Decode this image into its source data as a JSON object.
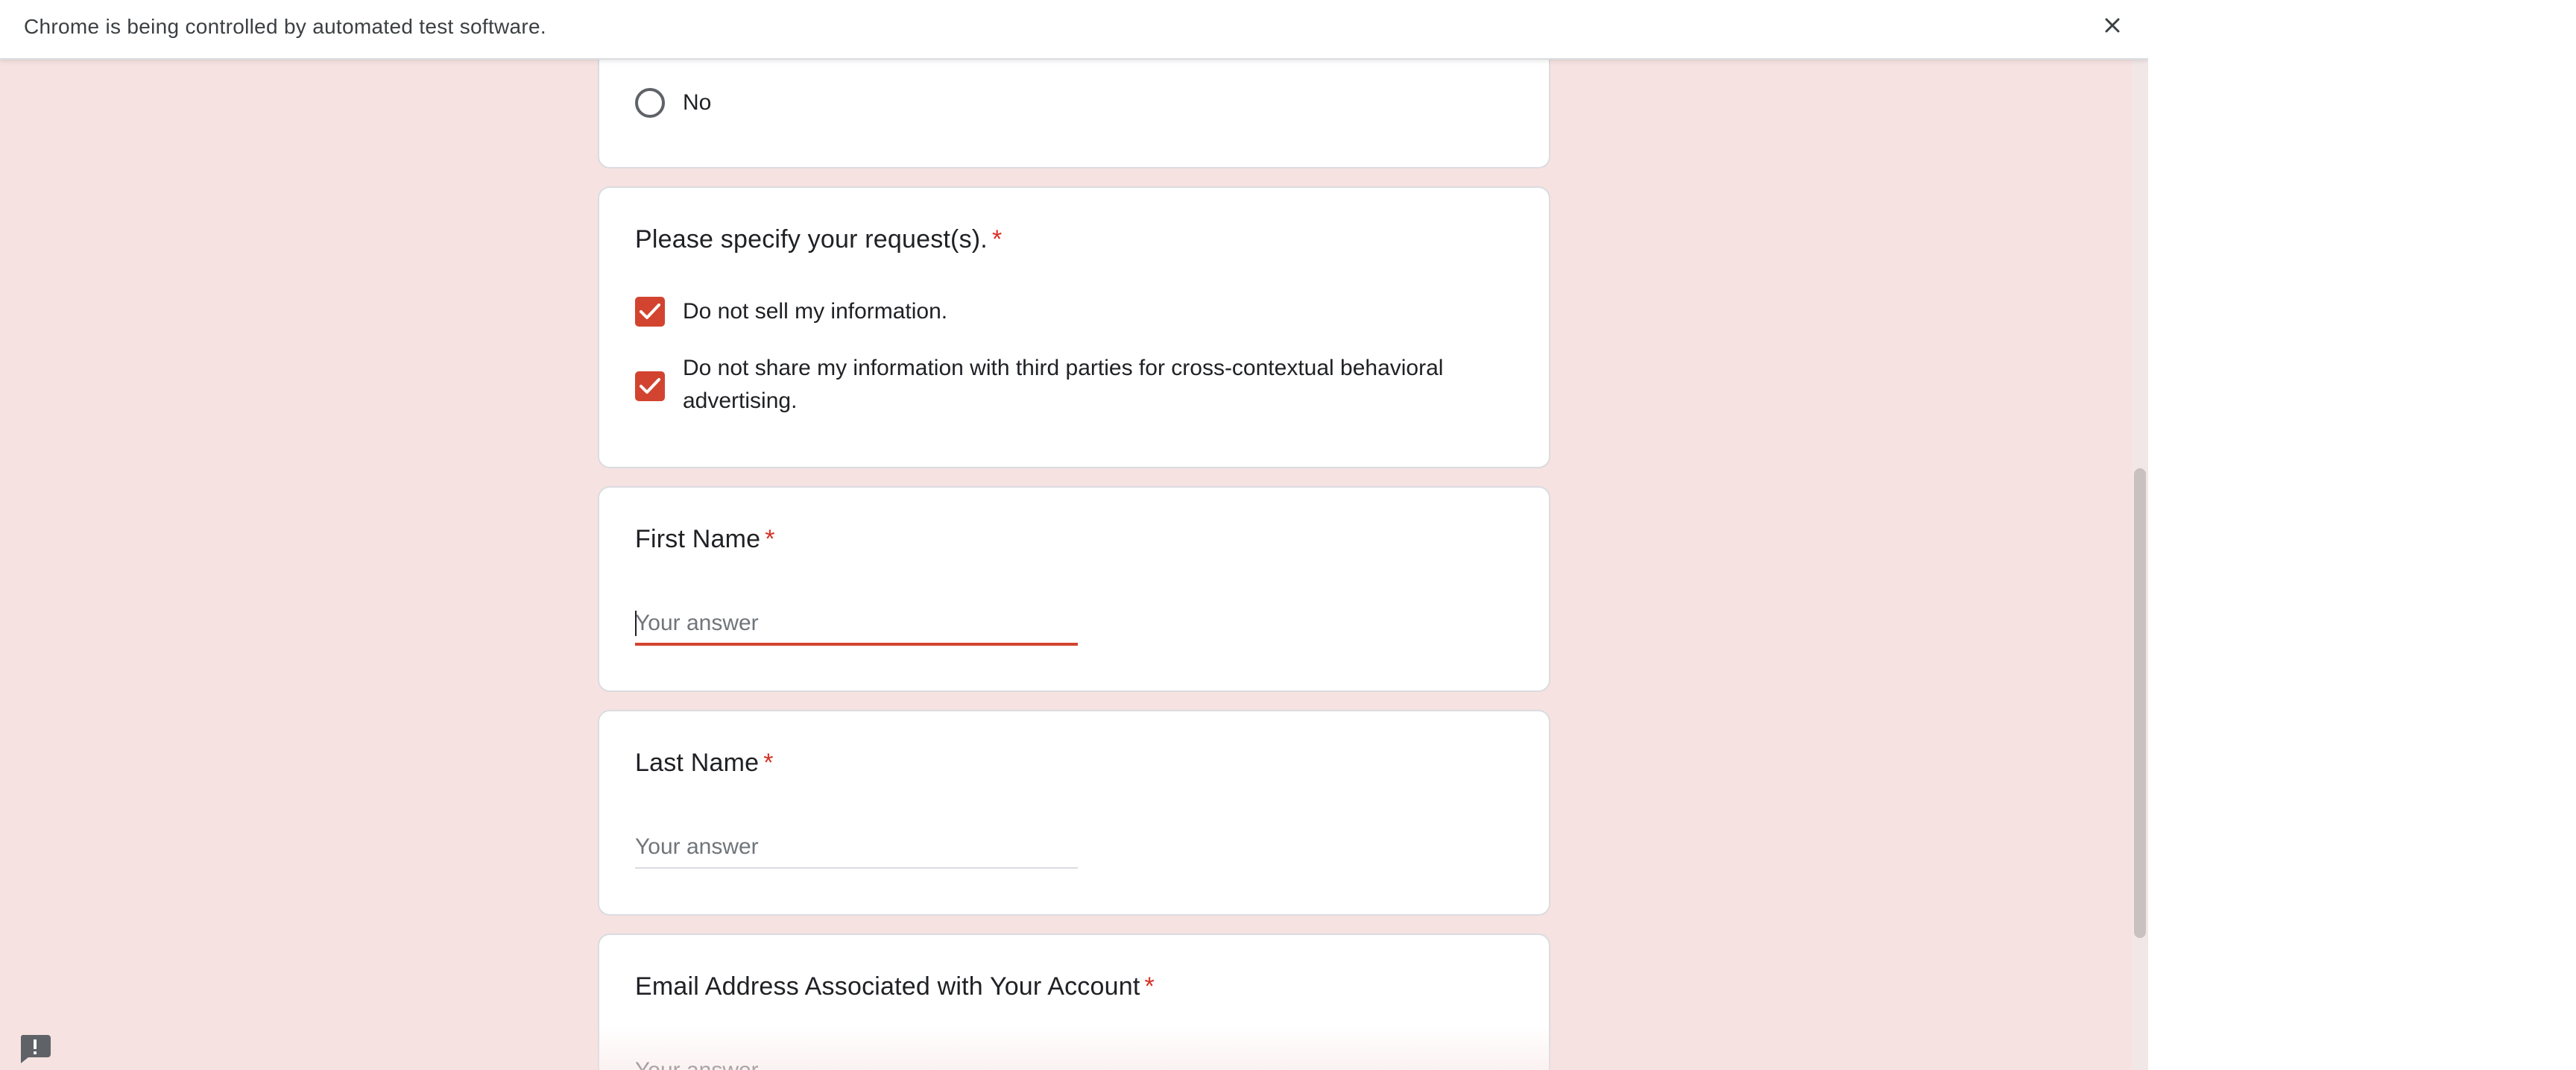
{
  "infobar": {
    "message": "Chrome is being controlled by automated test software.",
    "close_icon": "close-icon"
  },
  "form": {
    "previous_question": {
      "option_label": "No",
      "selected": false
    },
    "request_question": {
      "title": "Please specify your request(s).",
      "required_mark": "*",
      "options": [
        {
          "label": "Do not sell my information.",
          "checked": true
        },
        {
          "label": "Do not share my information with third parties for cross-contextual behavioral advertising.",
          "checked": true
        }
      ]
    },
    "first_name": {
      "title": "First Name",
      "required_mark": "*",
      "placeholder": "Your answer",
      "value": ""
    },
    "last_name": {
      "title": "Last Name",
      "required_mark": "*",
      "placeholder": "Your answer",
      "value": ""
    },
    "email": {
      "title": "Email Address Associated with Your Account",
      "required_mark": "*",
      "placeholder": "Your answer",
      "value": ""
    }
  },
  "report_button": {
    "icon": "report-problem-icon"
  },
  "colors": {
    "accent": "#d2442f",
    "required": "#d93025",
    "page_background": "#f6e2e1",
    "card_border": "#dadce0"
  }
}
